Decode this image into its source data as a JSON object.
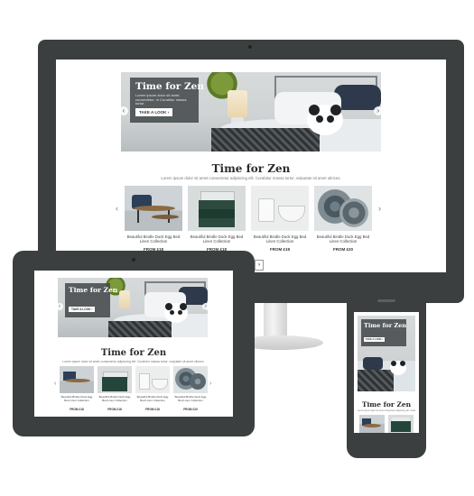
{
  "promo": {
    "title": "Time for Zen",
    "subtitle": "Lorem ipsum dolor sit amet, consectetur. In Curabitur massa tortor.",
    "button": "TAKE A LOOK"
  },
  "section": {
    "title": "Time for Zen",
    "description": "Lorem ipsum dolor sit amet consectetur adipiscing elit. Curabitur massa tortor, vulputate sit amet ultrices."
  },
  "products": [
    {
      "name": "Beautiful Bindle Duck Egg Bed Linen Collection",
      "price": "FROM £18",
      "icon": "coffee-table-image"
    },
    {
      "name": "Beautiful Bindle Duck Egg Bed Linen Collection",
      "price": "FROM £18",
      "icon": "folded-towels-image"
    },
    {
      "name": "Beautiful Bindle Duck Egg Bed Linen Collection",
      "price": "FROM £18",
      "icon": "mugs-bowls-image"
    },
    {
      "name": "Beautiful Bindle Duck Egg Bed Linen Collection",
      "price": "FROM £20",
      "icon": "plates-image"
    }
  ],
  "colors": {
    "bezel": "#3b3f40",
    "promo_overlay": "#464a4c",
    "accent_navy": "#1f3b4d"
  }
}
